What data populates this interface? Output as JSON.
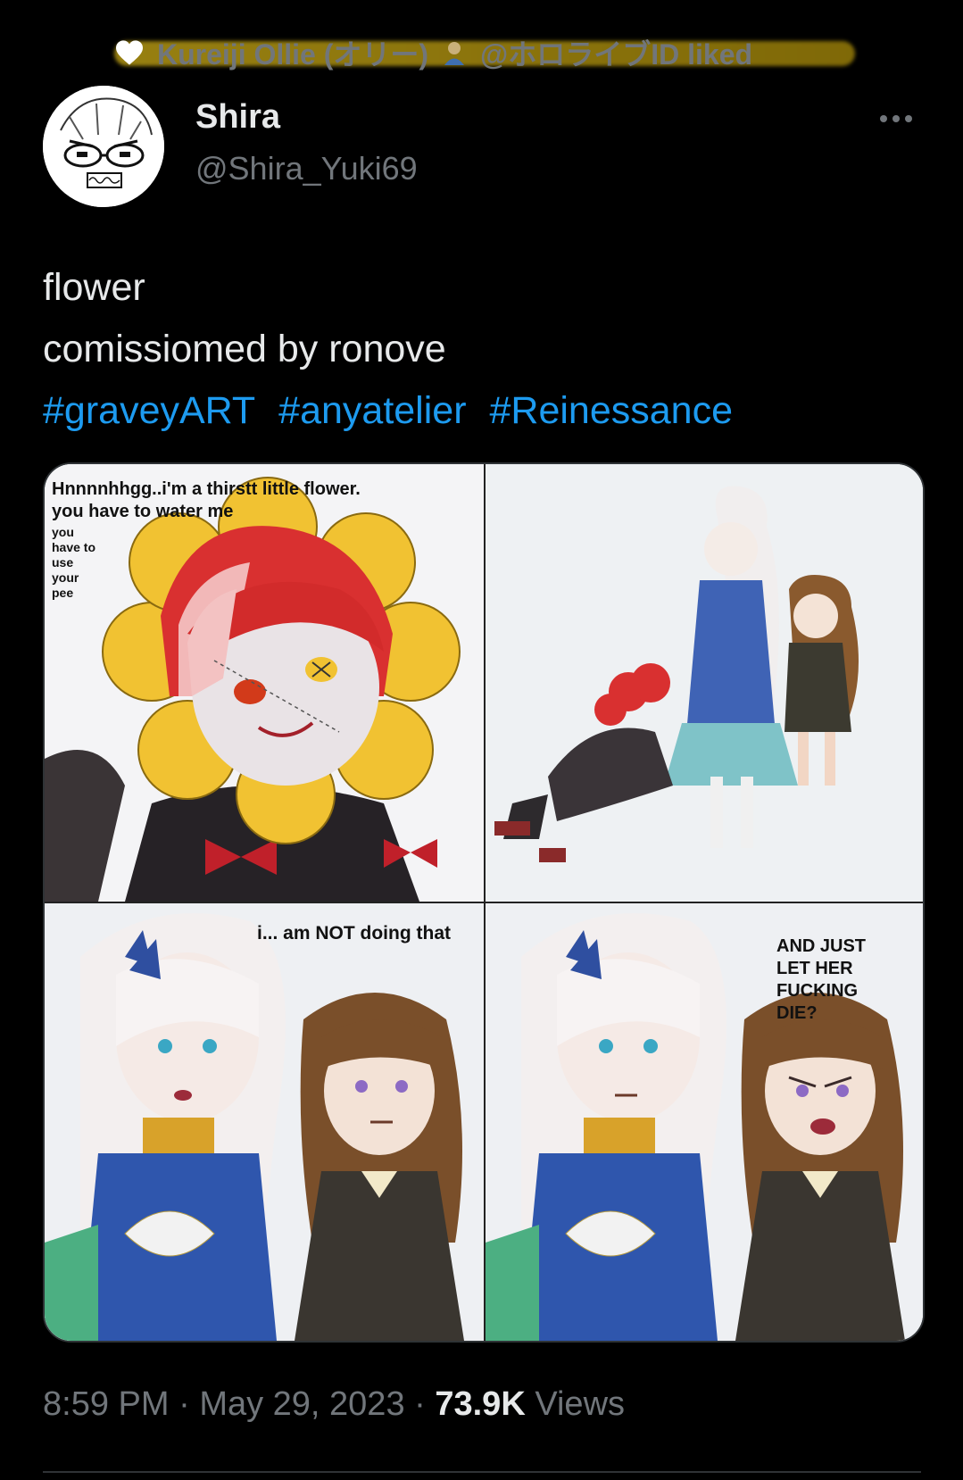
{
  "social_context": {
    "liked_by": "Kureiji Ollie (オリー)",
    "liked_suffix": "@ホロライブID liked",
    "icon": "heart-icon"
  },
  "author": {
    "display_name": "Shira",
    "handle": "@Shira_Yuki69"
  },
  "tweet": {
    "line1": "flower",
    "line2": "comissiomed by ronove",
    "hashtags": [
      "#graveyART",
      "#anyatelier",
      "#Reinessance"
    ]
  },
  "comic": {
    "panel1_caption": "Hnnnnhhgg..i'm a thirstt little flower.\nyou have to water me",
    "panel1_small": "you\nhave to\nuse\nyour\npee",
    "panel3_caption": "i... am NOT doing that",
    "panel4_caption": "AND JUST\nLET HER\nFUCKING\nDIE?"
  },
  "meta": {
    "time": "8:59 PM",
    "separator": "·",
    "date": "May 29, 2023",
    "views_count": "73.9K",
    "views_label": "Views"
  },
  "colors": {
    "background": "#000000",
    "link": "#1d9bf0",
    "muted": "#71767b",
    "text": "#e7e9ea"
  }
}
